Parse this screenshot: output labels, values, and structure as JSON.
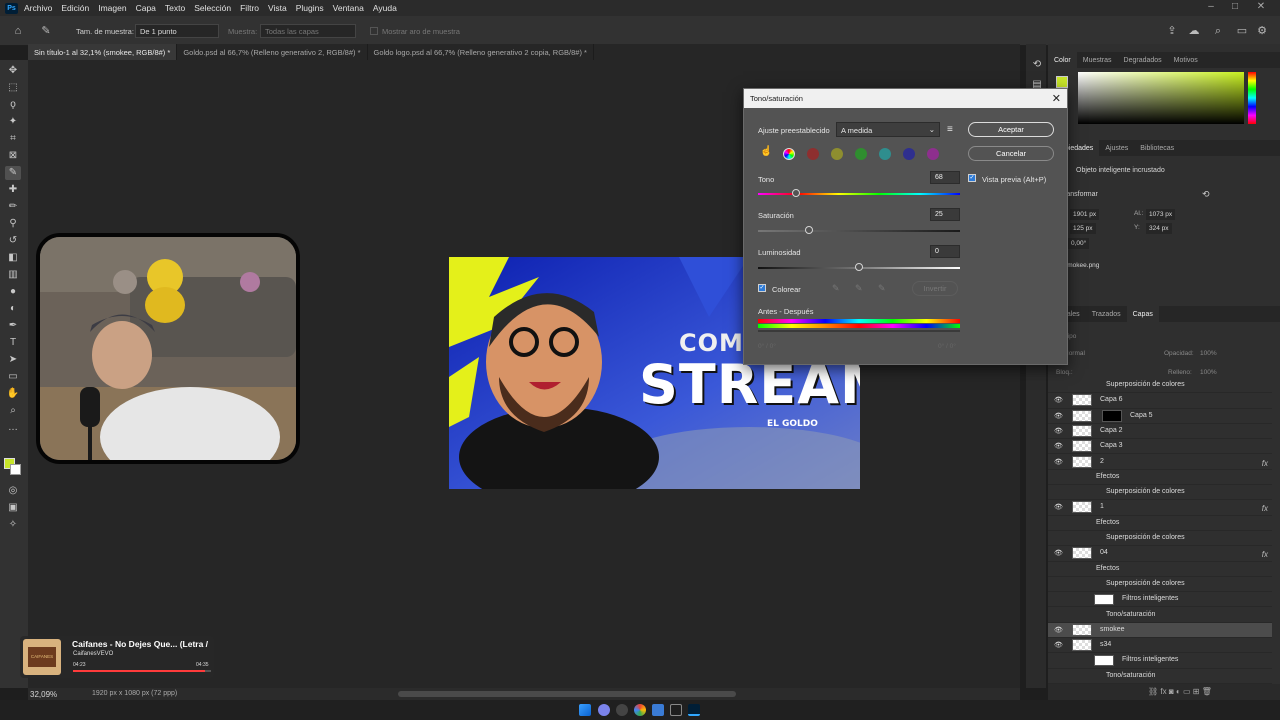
{
  "menubar": {
    "logo": "Ps",
    "items": [
      "Archivo",
      "Edición",
      "Imagen",
      "Capa",
      "Texto",
      "Selección",
      "Filtro",
      "Vista",
      "Plugins",
      "Ventana",
      "Ayuda"
    ],
    "window_controls": [
      "–",
      "□",
      "✕"
    ]
  },
  "options_bar": {
    "sample_size_label": "Tam. de muestra:",
    "sample_size_value": "De 1 punto",
    "sample_label": "Muestra:",
    "sample_value": "Todas las capas",
    "show_ring_label": "Mostrar aro de muestra"
  },
  "doc_tabs": [
    {
      "label": "Sin título-1 al 32,1% (smokee, RGB/8#) *",
      "active": true
    },
    {
      "label": "Goldo.psd al 66,7% (Relleno generativo 2, RGB/8#) *",
      "active": false
    },
    {
      "label": "Goldo logo.psd al 66,7% (Relleno generativo 2 copia, RGB/8#) *",
      "active": false
    }
  ],
  "thumbnail": {
    "line1": "COMEN",
    "line2": "STREAM",
    "brand": "EL GOLDO"
  },
  "statusbar": {
    "zoom": "32,09%",
    "doc_info": "1920 px x 1080 px (72 ppp)"
  },
  "mini_player": {
    "title": "Caifanes - No Dejes Que... (Letra /",
    "channel": "CaifanesVEVO",
    "elapsed": "04:23",
    "duration": "04:35",
    "progress": 0.96,
    "thumb_text": "CAIFANES"
  },
  "dialog": {
    "title": "Tono/saturación",
    "preset_label": "Ajuste preestablecido",
    "preset_value": "A medida",
    "ok_label": "Aceptar",
    "cancel_label": "Cancelar",
    "hue_label": "Tono",
    "hue_value": "68",
    "saturation_label": "Saturación",
    "saturation_value": "25",
    "lightness_label": "Luminosidad",
    "lightness_value": "0",
    "preview_label": "Vista previa (Alt+P)",
    "colorize_label": "Colorear",
    "invert_label": "Invertir",
    "before_after_label": "Antes - Después",
    "hue_fraction": 0.19,
    "saturation_fraction": 0.25,
    "lightness_fraction": 0.5,
    "range_left": "0° / 0°",
    "range_right": "0° / 0°",
    "swatch_colors": [
      "#8e2f2f",
      "#8e8e2f",
      "#2f8e2f",
      "#2f8e8e",
      "#2f2f8e",
      "#8e2f8e"
    ]
  },
  "color_panel": {
    "tabs": [
      "Color",
      "Muestras",
      "Degradados",
      "Motivos"
    ],
    "fg_color": "#c8e62a"
  },
  "properties_panel": {
    "tabs": [
      "Propiedades",
      "Ajustes",
      "Bibliotecas"
    ],
    "object_label": "Objeto inteligente incrustado",
    "transform_label": "Transformar",
    "w_value": "1901 px",
    "h_label": "Al.:",
    "h_value": "1073 px",
    "x_value": "125 px",
    "y_label": "Y:",
    "y_value": "324 px",
    "angle_value": "0,00°",
    "file_name": "smokee.png"
  },
  "layers_panel": {
    "tabs": [
      "Canales",
      "Trazados",
      "Capas"
    ],
    "kind_placeholder": "Tipo",
    "mode_value": "Normal",
    "opacity_label": "Opacidad:",
    "opacity_value": "100%",
    "lock_label": "Bloq.:",
    "fill_label": "Relleno:",
    "fill_value": "100%",
    "layers": [
      {
        "name": "Superposición de colores",
        "kind": "effect-sub"
      },
      {
        "name": "Capa 6",
        "kind": "layer"
      },
      {
        "name": "Capa 5",
        "kind": "layer-mask"
      },
      {
        "name": "Capa 2",
        "kind": "layer"
      },
      {
        "name": "Capa 3",
        "kind": "layer"
      },
      {
        "name": "2",
        "kind": "layer-fx"
      },
      {
        "name": "Efectos",
        "kind": "effect-head"
      },
      {
        "name": "Superposición de colores",
        "kind": "effect-sub"
      },
      {
        "name": "1",
        "kind": "layer-fx"
      },
      {
        "name": "Efectos",
        "kind": "effect-head"
      },
      {
        "name": "Superposición de colores",
        "kind": "effect-sub"
      },
      {
        "name": "04",
        "kind": "layer-fx"
      },
      {
        "name": "Efectos",
        "kind": "effect-head"
      },
      {
        "name": "Superposición de colores",
        "kind": "effect-sub"
      },
      {
        "name": "Filtros inteligentes",
        "kind": "filter-head"
      },
      {
        "name": "Tono/saturación",
        "kind": "filter-sub"
      },
      {
        "name": "smokee",
        "kind": "layer-selected"
      },
      {
        "name": "s34",
        "kind": "layer"
      },
      {
        "name": "Filtros inteligentes",
        "kind": "filter-head"
      },
      {
        "name": "Tono/saturación",
        "kind": "filter-sub"
      }
    ]
  }
}
